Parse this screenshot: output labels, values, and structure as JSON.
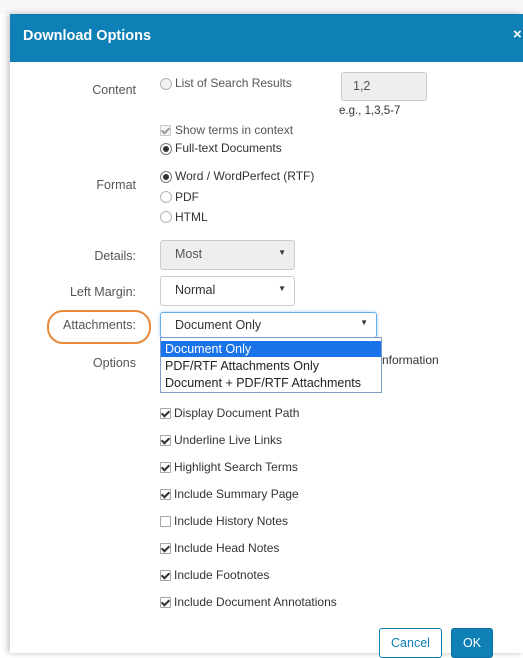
{
  "dialog": {
    "title": "Download Options",
    "close_glyph": "×"
  },
  "content": {
    "label": "Content",
    "list_option": "List of Search Results",
    "range_value": "1,2",
    "range_hint": "e.g., 1,3,5-7",
    "show_terms": "Show terms in context",
    "fulltext_option": "Full-text Documents"
  },
  "format": {
    "label": "Format",
    "options": [
      "Word / WordPerfect (RTF)",
      "PDF",
      "HTML"
    ],
    "selected": "Word / WordPerfect (RTF)"
  },
  "details": {
    "label": "Details:",
    "value": "Most"
  },
  "left_margin": {
    "label": "Left Margin:",
    "value": "Normal"
  },
  "attachments": {
    "label": "Attachments:",
    "value": "Document Only",
    "dropdown_options": [
      "Document Only",
      "PDF/RTF Attachments Only",
      "Document + PDF/RTF Attachments"
    ],
    "selected_index": 0
  },
  "options": {
    "label": "Options",
    "partial_text": "nformation",
    "items": [
      {
        "label": "Display Document Path",
        "checked": true
      },
      {
        "label": "Underline Live Links",
        "checked": true
      },
      {
        "label": "Highlight Search Terms",
        "checked": true
      },
      {
        "label": "Include Summary Page",
        "checked": true
      },
      {
        "label": "Include History Notes",
        "checked": false
      },
      {
        "label": "Include Head Notes",
        "checked": true
      },
      {
        "label": "Include Footnotes",
        "checked": true
      },
      {
        "label": "Include Document Annotations",
        "checked": true
      }
    ]
  },
  "buttons": {
    "cancel": "Cancel",
    "ok": "OK"
  },
  "colors": {
    "header": "#0e80b6",
    "highlight_ring": "#e8893a",
    "dropdown_selected": "#1a73e8"
  },
  "icons": {
    "close": "close-icon",
    "caret": "chevron-down-icon"
  }
}
